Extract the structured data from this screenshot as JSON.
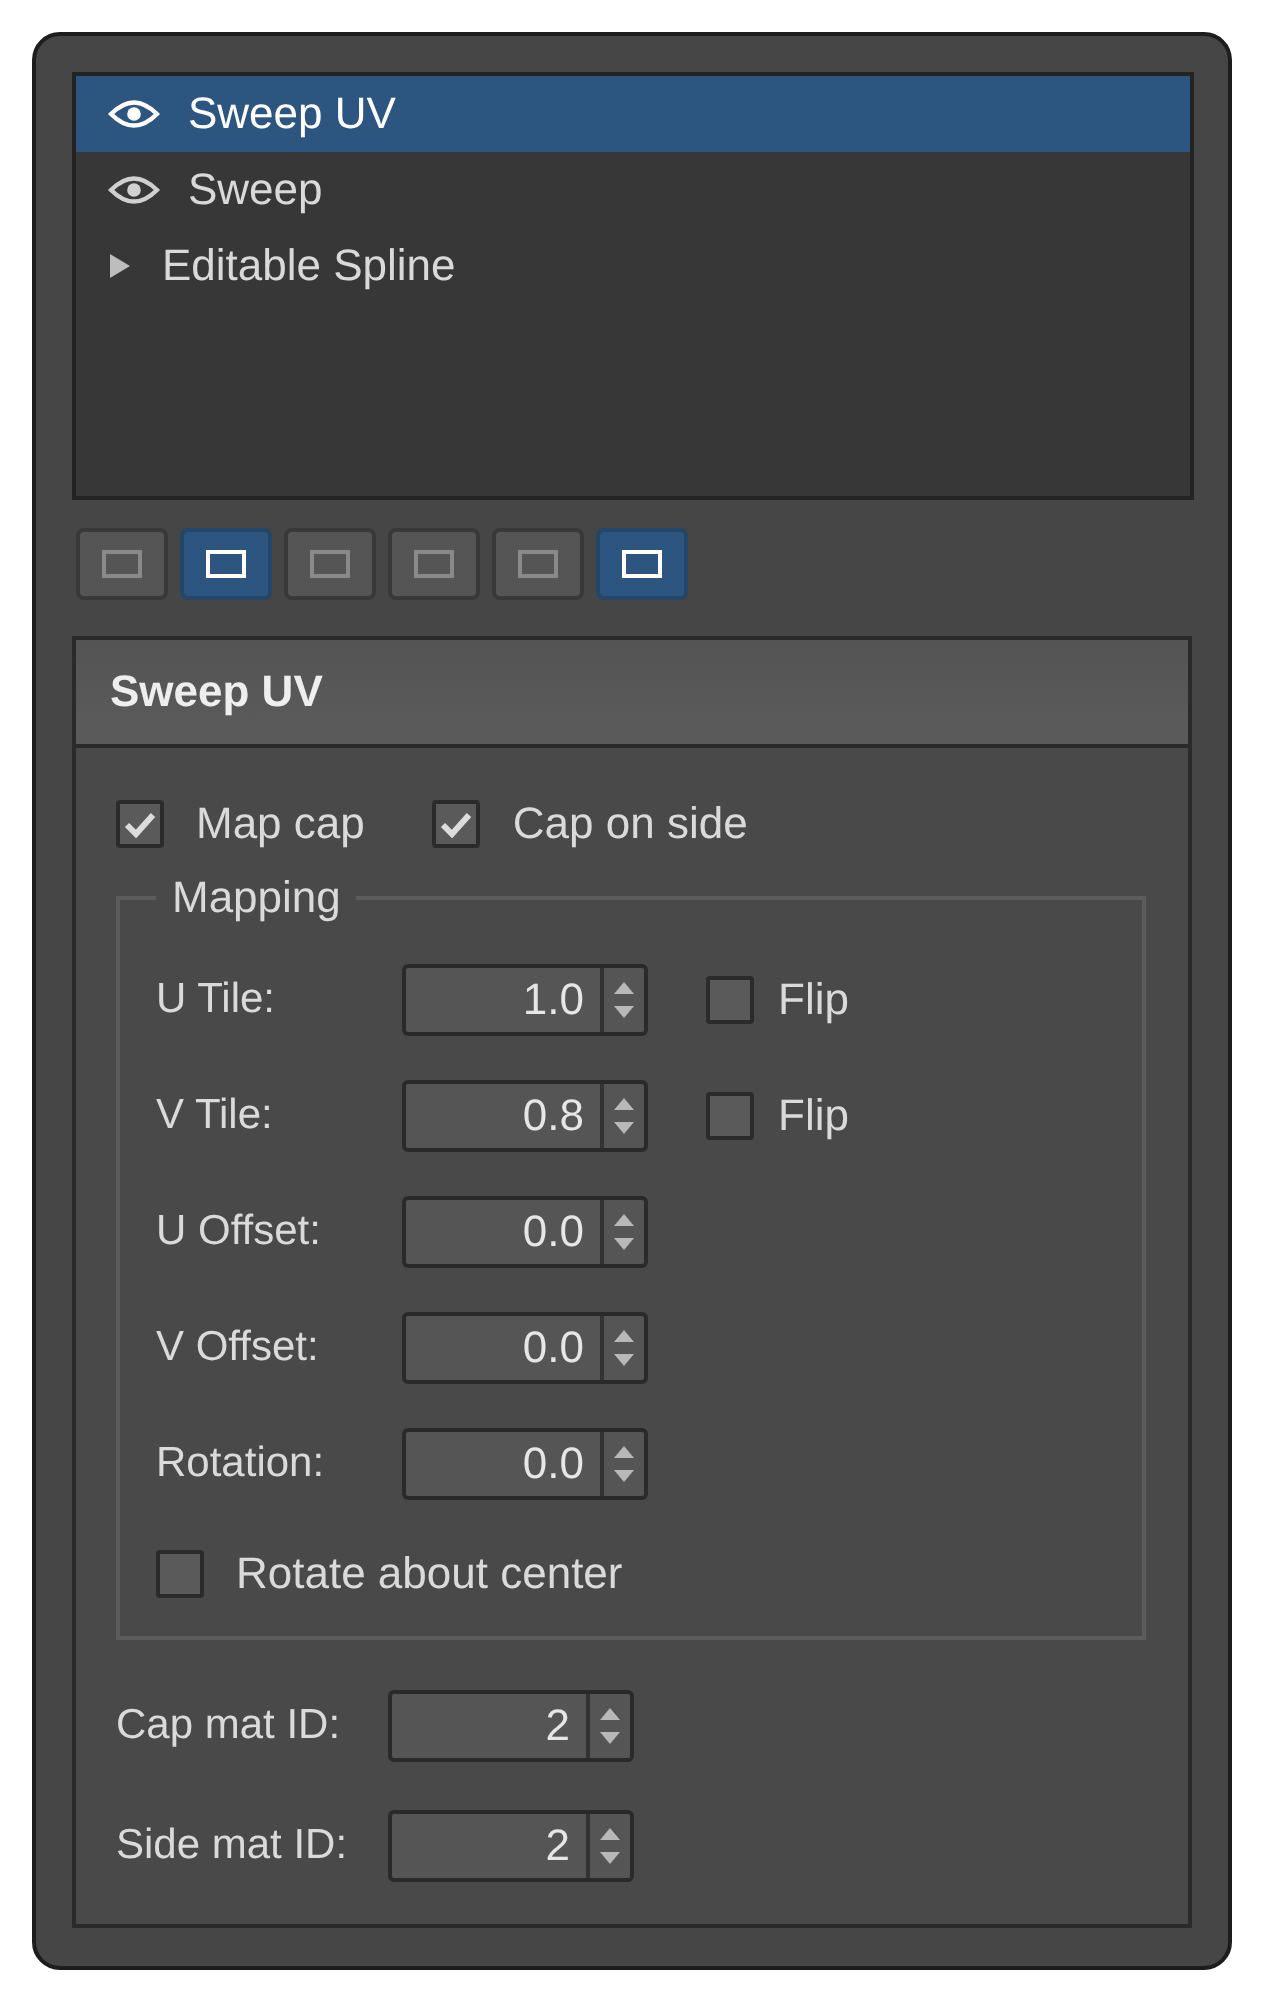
{
  "stack": {
    "items": [
      {
        "label": "Sweep UV",
        "kind": "modifier",
        "selected": true
      },
      {
        "label": "Sweep",
        "kind": "modifier",
        "selected": false
      },
      {
        "label": "Editable Spline",
        "kind": "object",
        "selected": false,
        "expanded": false
      }
    ]
  },
  "toolbar": {
    "buttons": [
      {
        "on": false
      },
      {
        "on": true
      },
      {
        "on": false
      },
      {
        "on": false
      },
      {
        "on": false
      },
      {
        "on": true
      }
    ]
  },
  "rollout": {
    "title": "Sweep UV",
    "options": [
      {
        "label": "Map cap",
        "checked": true
      },
      {
        "label": "Cap on side",
        "checked": true
      }
    ],
    "mapping": {
      "title": "Mapping",
      "rows": [
        {
          "label": "U Tile:",
          "value": "1.0",
          "flip": {
            "label": "Flip",
            "checked": false
          }
        },
        {
          "label": "V Tile:",
          "value": "0.8",
          "flip": {
            "label": "Flip",
            "checked": false
          }
        },
        {
          "label": "U Offset:",
          "value": "0.0"
        },
        {
          "label": "V Offset:",
          "value": "0.0"
        },
        {
          "label": "Rotation:",
          "value": "0.0"
        }
      ],
      "rotate_about_center": {
        "label": "Rotate about center",
        "checked": false
      }
    },
    "material_ids": [
      {
        "label": "Cap mat ID:",
        "value": "2"
      },
      {
        "label": "Side mat ID:",
        "value": "2"
      }
    ]
  }
}
